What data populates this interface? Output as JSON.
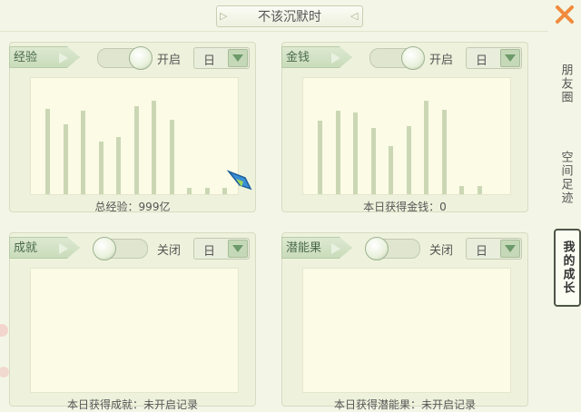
{
  "window": {
    "title": "不该沉默时",
    "accent": "#f08a3c"
  },
  "side_tabs": [
    {
      "label": "朋友圈",
      "active": false
    },
    {
      "label": "空间足迹",
      "active": false
    },
    {
      "label": "我的成长",
      "active": true
    }
  ],
  "panels": {
    "experience": {
      "label": "经验",
      "toggle_text": "开启",
      "toggle_on": true,
      "period": "日",
      "summary": "总经验：999亿",
      "chart_data": {
        "type": "bar",
        "values": [
          0.88,
          0.72,
          0.86,
          0.54,
          0.59,
          0.91,
          0.97,
          0.77,
          0.07,
          0.07,
          0.07
        ]
      }
    },
    "money": {
      "label": "金钱",
      "toggle_text": "开启",
      "toggle_on": true,
      "period": "日",
      "summary": "本日获得金钱：0",
      "chart_data": {
        "type": "bar",
        "values": [
          0.76,
          0.86,
          0.84,
          0.68,
          0.5,
          0.7,
          0.97,
          0.87,
          0.08,
          0.08
        ]
      }
    },
    "achievement": {
      "label": "成就",
      "toggle_text": "关闭",
      "toggle_on": false,
      "period": "日",
      "summary": "本日获得成就：未开启记录"
    },
    "potential": {
      "label": "潜能果",
      "toggle_text": "关闭",
      "toggle_on": false,
      "period": "日",
      "summary": "本日获得潜能果：未开启记录"
    }
  }
}
